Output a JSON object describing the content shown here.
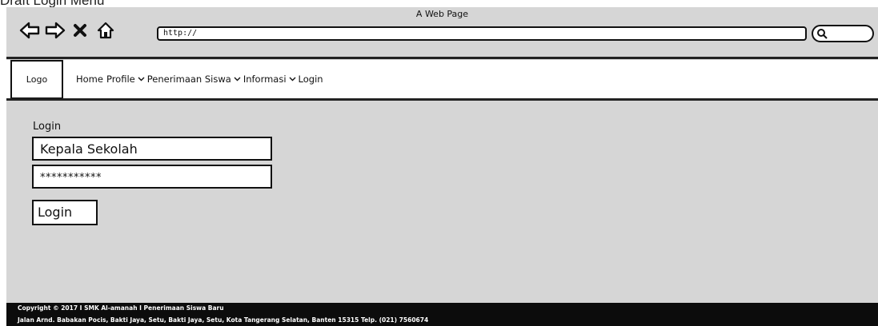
{
  "caption": "Draft Login Menu",
  "browser": {
    "title": "A Web Page",
    "url": "http://",
    "icons": [
      "back-arrow-icon",
      "forward-arrow-icon",
      "close-icon",
      "home-icon",
      "search-icon"
    ]
  },
  "navbar": {
    "logo": "Logo",
    "items": [
      {
        "label": "Home",
        "dropdown": false
      },
      {
        "label": "Profile",
        "dropdown": true
      },
      {
        "label": "Penerimaan Siswa",
        "dropdown": true
      },
      {
        "label": "Informasi",
        "dropdown": true
      },
      {
        "label": "Login",
        "dropdown": false
      }
    ]
  },
  "login": {
    "title": "Login",
    "username_value": "Kepala Sekolah",
    "password_value": "***********",
    "button_label": "Login"
  },
  "footer": {
    "line1": "Copyright © 2017 I SMK Al-amanah I Penerimaan Siswa Baru",
    "line2": "Jalan Arnd. Babakan Pocis, Bakti Jaya, Setu, Bakti Jaya, Setu, Kota Tangerang Selatan, Banten 15315 Telp. (021) 7560674"
  },
  "colors": {
    "canvas": "#d6d6d6",
    "footer": "#0c0c0c",
    "stroke": "#111111"
  }
}
